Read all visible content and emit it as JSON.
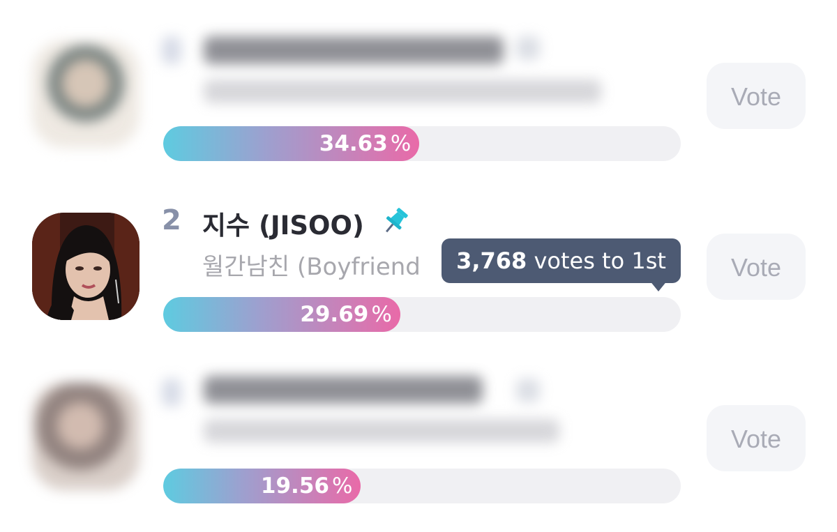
{
  "rows": [
    {
      "blurred": true,
      "vote_label": "Vote",
      "percent_value": "34.63",
      "percent_symbol": "%",
      "percent_fill": 0.495
    },
    {
      "blurred": false,
      "rank": "2",
      "name": "지수 (JISOO)",
      "subtitle": "월간남친 (Boyfriend",
      "vote_label": "Vote",
      "percent_value": "29.69",
      "percent_symbol": "%",
      "percent_fill": 0.458,
      "tooltip": {
        "votes": "3,768",
        "text": " votes to 1st"
      }
    },
    {
      "blurred": true,
      "vote_label": "Vote",
      "percent_value": "19.56",
      "percent_symbol": "%",
      "percent_fill": 0.382
    }
  ],
  "colors": {
    "bar_start": "#5ecbe0",
    "bar_end": "#e96aa8",
    "tooltip_bg": "#4d5a73",
    "pin": "#26c3d9"
  },
  "icons": {
    "pin": "pin-icon"
  }
}
